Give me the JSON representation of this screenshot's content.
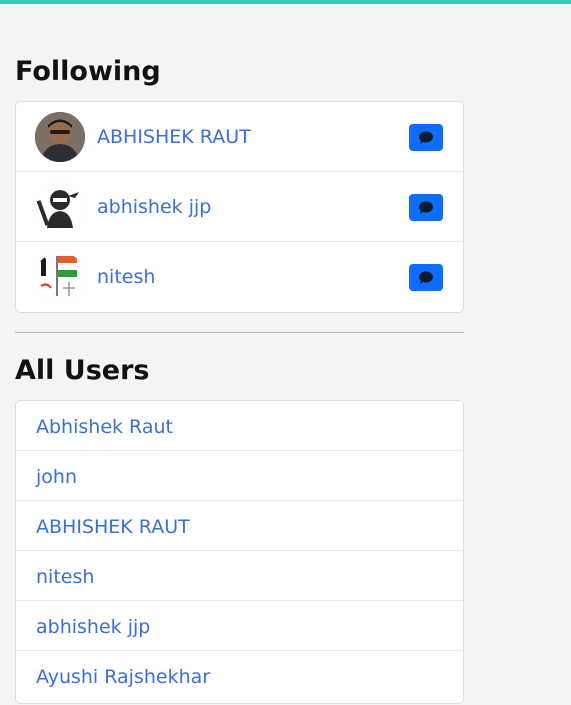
{
  "accent_color": "#3cc8c0",
  "link_color": "#3a6fd8",
  "button_color": "#0d6efd",
  "following": {
    "title": "Following",
    "users": [
      {
        "name": "ABHISHEK RAUT",
        "avatar": "photo-avatar",
        "action_icon": "chat-bubble-icon"
      },
      {
        "name": "abhishek jjp",
        "avatar": "ninja-avatar",
        "action_icon": "chat-bubble-icon"
      },
      {
        "name": "nitesh",
        "avatar": "flag-avatar",
        "action_icon": "chat-bubble-icon"
      }
    ]
  },
  "all_users": {
    "title": "All Users",
    "users": [
      {
        "name": "Abhishek Raut"
      },
      {
        "name": "john"
      },
      {
        "name": "ABHISHEK RAUT"
      },
      {
        "name": "nitesh"
      },
      {
        "name": "abhishek jjp"
      },
      {
        "name": "Ayushi Rajshekhar"
      }
    ]
  }
}
